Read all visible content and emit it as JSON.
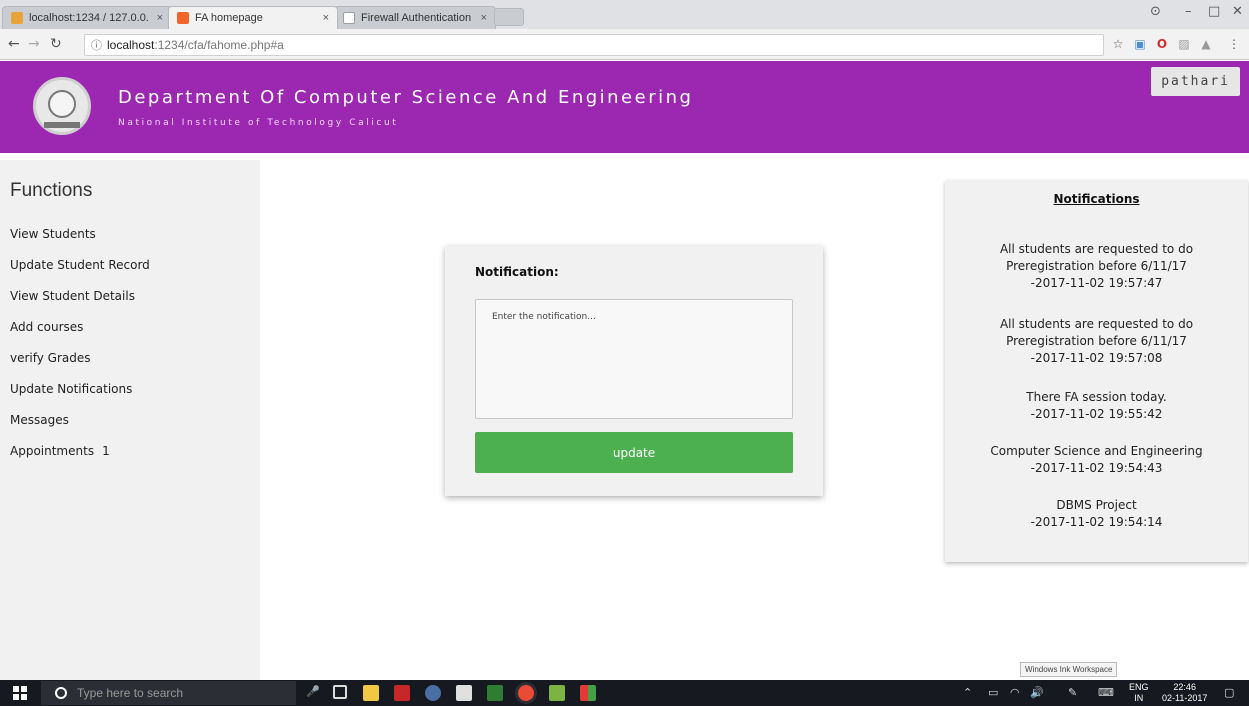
{
  "browser": {
    "tabs": [
      {
        "title": "localhost:1234 / 127.0.0.",
        "active": false,
        "favicon_color": "#e8a33a"
      },
      {
        "title": "FA homepage",
        "active": true,
        "favicon_color": "#f16529"
      },
      {
        "title": "Firewall Authentication K",
        "active": false,
        "favicon_color": "#9e9e9e"
      }
    ],
    "url_host": "localhost",
    "url_path": ":1234/cfa/fahome.php#a"
  },
  "header": {
    "title": "Department Of Computer Science And Engineering",
    "subtitle": "National Institute of Technology Calicut",
    "username": "pathari"
  },
  "sidebar": {
    "title": "Functions",
    "items": [
      {
        "label": "View Students"
      },
      {
        "label": "Update Student Record"
      },
      {
        "label": "View Student Details"
      },
      {
        "label": "Add courses"
      },
      {
        "label": "verify Grades"
      },
      {
        "label": "Update Notifications"
      },
      {
        "label": "Messages"
      },
      {
        "label": "Appointments",
        "badge": "1"
      }
    ]
  },
  "form": {
    "label": "Notification:",
    "placeholder": "Enter the notification...",
    "button_label": "update"
  },
  "notifications": {
    "title": "Notifications",
    "items": [
      {
        "lines": [
          "All students are requested to do",
          "Preregistration before 6/11/17",
          "-2017-11-02 19:57:47"
        ]
      },
      {
        "lines": [
          "All students are requested to do",
          "Preregistration before 6/11/17",
          "-2017-11-02 19:57:08"
        ]
      },
      {
        "lines": [
          "There FA session today.",
          "-2017-11-02 19:55:42"
        ]
      },
      {
        "lines": [
          "Computer Science and Engineering",
          "-2017-11-02 19:54:43"
        ]
      },
      {
        "lines": [
          "DBMS Project",
          "-2017-11-02 19:54:14"
        ]
      }
    ]
  },
  "taskbar": {
    "search_placeholder": "Type here to search",
    "lang_line1": "ENG",
    "lang_line2": "IN",
    "time": "22:46",
    "date": "02-11-2017",
    "tooltip": "Windows Ink Workspace"
  },
  "colors": {
    "header_bg": "#9c27b0",
    "button_bg": "#4caf50",
    "panel_bg": "#f1f1f1"
  }
}
